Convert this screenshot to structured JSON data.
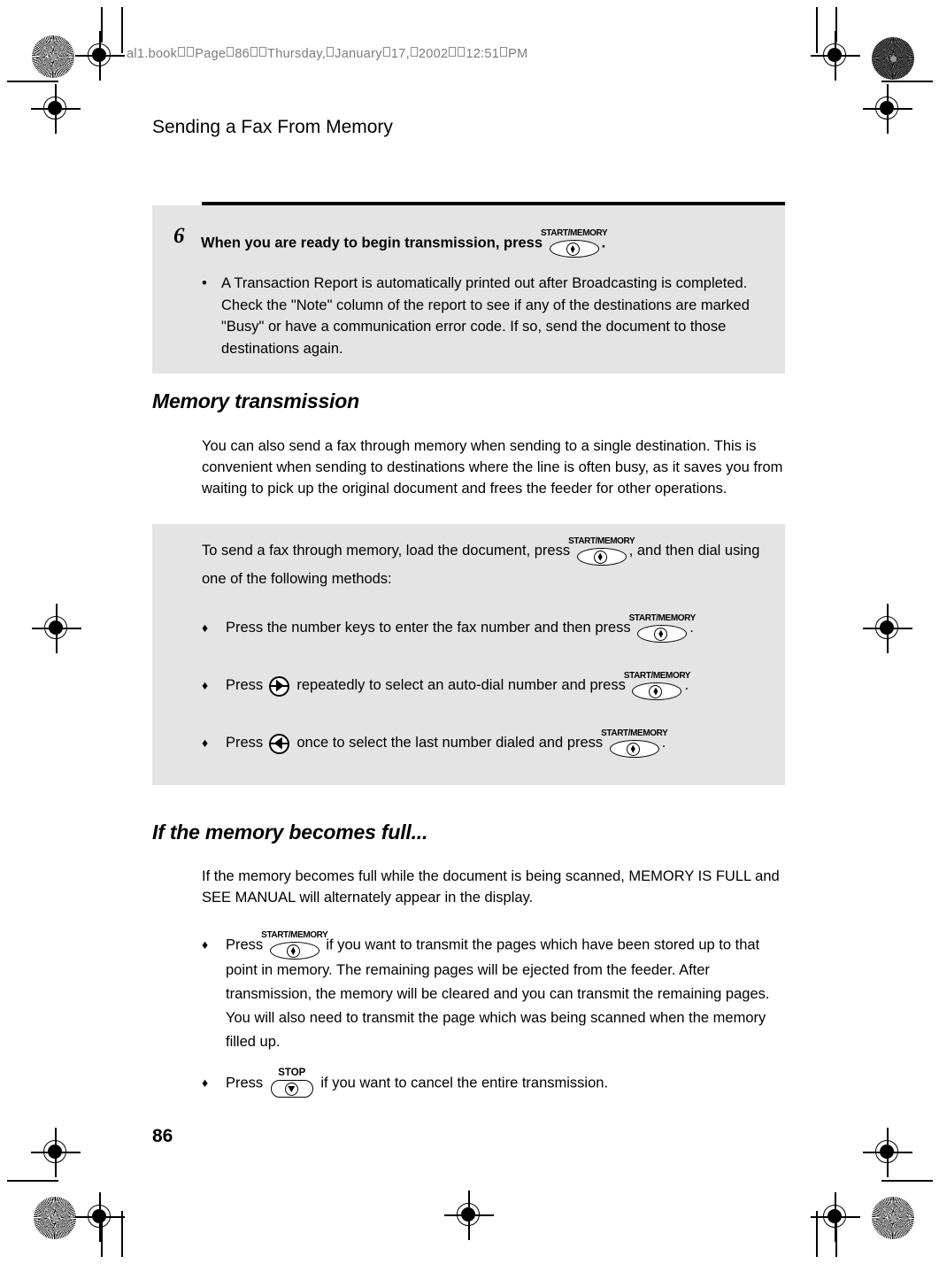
{
  "page": {
    "file_header": "al1.book  Page 86  Thursday, January 17, 2002  12:51 PM",
    "running_head": "Sending a Fax From Memory",
    "page_number": "86"
  },
  "keys": {
    "start_memory": "START/MEMORY",
    "stop": "STOP",
    "arrow_right": "arrow-right-key",
    "arrow_left": "arrow-left-key"
  },
  "step6": {
    "number": "6",
    "instruction_before": "When you are ready to begin transmission, press",
    "instruction_after": ".",
    "bullet": "•",
    "note": "A Transaction Report is automatically printed out after Broadcasting is completed. Check the \"Note\" column of the report to see if any of the destinations are marked \"Busy\" or have a communication error code. If so, send the document to those destinations again."
  },
  "memory_transmission": {
    "heading": "Memory transmission",
    "paragraph": "You can also send a fax through memory when sending to a single destination. This is convenient when sending to destinations where the line is often busy, as it saves you from waiting to pick up the original document and frees the feeder for other operations.",
    "intro_part1": "To send a fax through memory, load the document, press",
    "intro_part2": ", and then dial using one of the following methods:",
    "diamond": "♦",
    "methods": [
      {
        "text_before": "Press the number keys to enter the fax number and then press",
        "text_middle": "",
        "text_after": ".",
        "has_arrow": false,
        "arrow_type": ""
      },
      {
        "text_before": "Press",
        "text_middle": "repeatedly to select an auto-dial number and press",
        "text_after": ".",
        "has_arrow": true,
        "arrow_type": "right"
      },
      {
        "text_before": "Press",
        "text_middle": "once to select the last number dialed and press",
        "text_after": ".",
        "has_arrow": true,
        "arrow_type": "left"
      }
    ]
  },
  "memory_full": {
    "heading": "If the memory becomes full...",
    "paragraph": "If the memory becomes full while the document is being scanned, MEMORY IS FULL and SEE MANUAL will alternately appear in the display.",
    "diamond": "♦",
    "note_transmit_before": "Press",
    "note_transmit_after": "if you want to transmit the pages which have been stored up to that point in memory. The remaining pages will be ejected from the feeder. After transmission, the memory will be cleared and you can transmit the remaining pages. You will also need to transmit the page which was being scanned when the memory filled up.",
    "note_cancel_before": "Press",
    "note_cancel_after": "if you want to cancel the entire transmission."
  }
}
